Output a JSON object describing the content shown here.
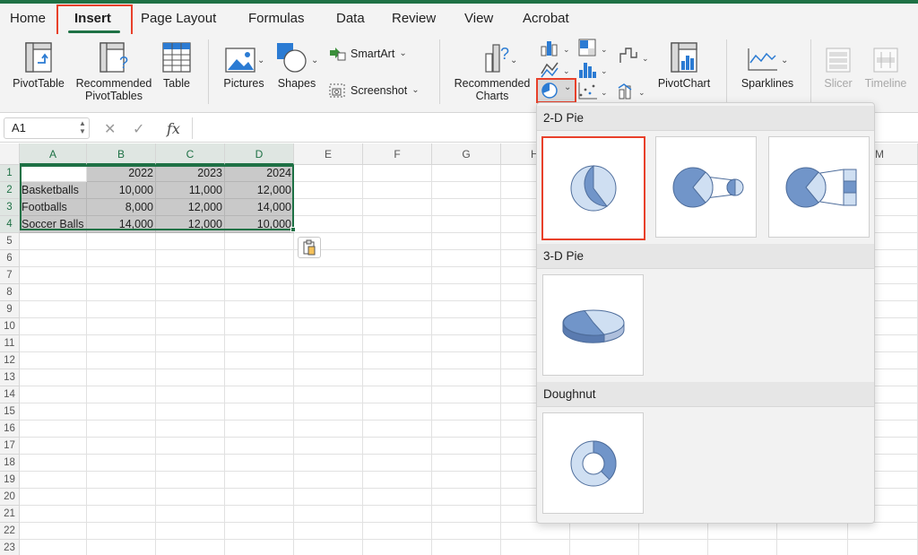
{
  "ribbon_tabs": [
    "Home",
    "Insert",
    "Page Layout",
    "Formulas",
    "Data",
    "Review",
    "View",
    "Acrobat"
  ],
  "active_tab": "Insert",
  "ribbon": {
    "pivottable": "PivotTable",
    "rec_pivot_1": "Recommended",
    "rec_pivot_2": "PivotTables",
    "table": "Table",
    "pictures": "Pictures",
    "shapes": "Shapes",
    "smartart": "SmartArt",
    "screenshot": "Screenshot",
    "rec_charts_1": "Recommended",
    "rec_charts_2": "Charts",
    "pivotchart": "PivotChart",
    "sparklines": "Sparklines",
    "slicer": "Slicer",
    "timeline": "Timeline"
  },
  "formula_bar": {
    "name_box": "A1",
    "fx": "fx",
    "formula": ""
  },
  "columns": [
    "A",
    "B",
    "C",
    "D",
    "E",
    "F",
    "G",
    "H",
    "M"
  ],
  "rows": [
    "1",
    "2",
    "3",
    "4",
    "5",
    "6",
    "7",
    "8",
    "9",
    "10",
    "11",
    "12",
    "13",
    "14",
    "15",
    "16",
    "17",
    "18",
    "19",
    "20",
    "21",
    "22",
    "23"
  ],
  "sheet": {
    "header": [
      "",
      "2022",
      "2023",
      "2024"
    ],
    "data": [
      [
        "Basketballs",
        "10,000",
        "11,000",
        "12,000"
      ],
      [
        "Footballs",
        "8,000",
        "12,000",
        "14,000"
      ],
      [
        "Soccer Balls",
        "14,000",
        "12,000",
        "10,000"
      ]
    ]
  },
  "chart_menu": {
    "sections": [
      "2-D Pie",
      "3-D Pie",
      "Doughnut"
    ]
  },
  "colors": {
    "accent": "#1e7145",
    "highlight_box": "#e8402a",
    "pie_dark": "#7195c9",
    "pie_light": "#cfdff2"
  }
}
